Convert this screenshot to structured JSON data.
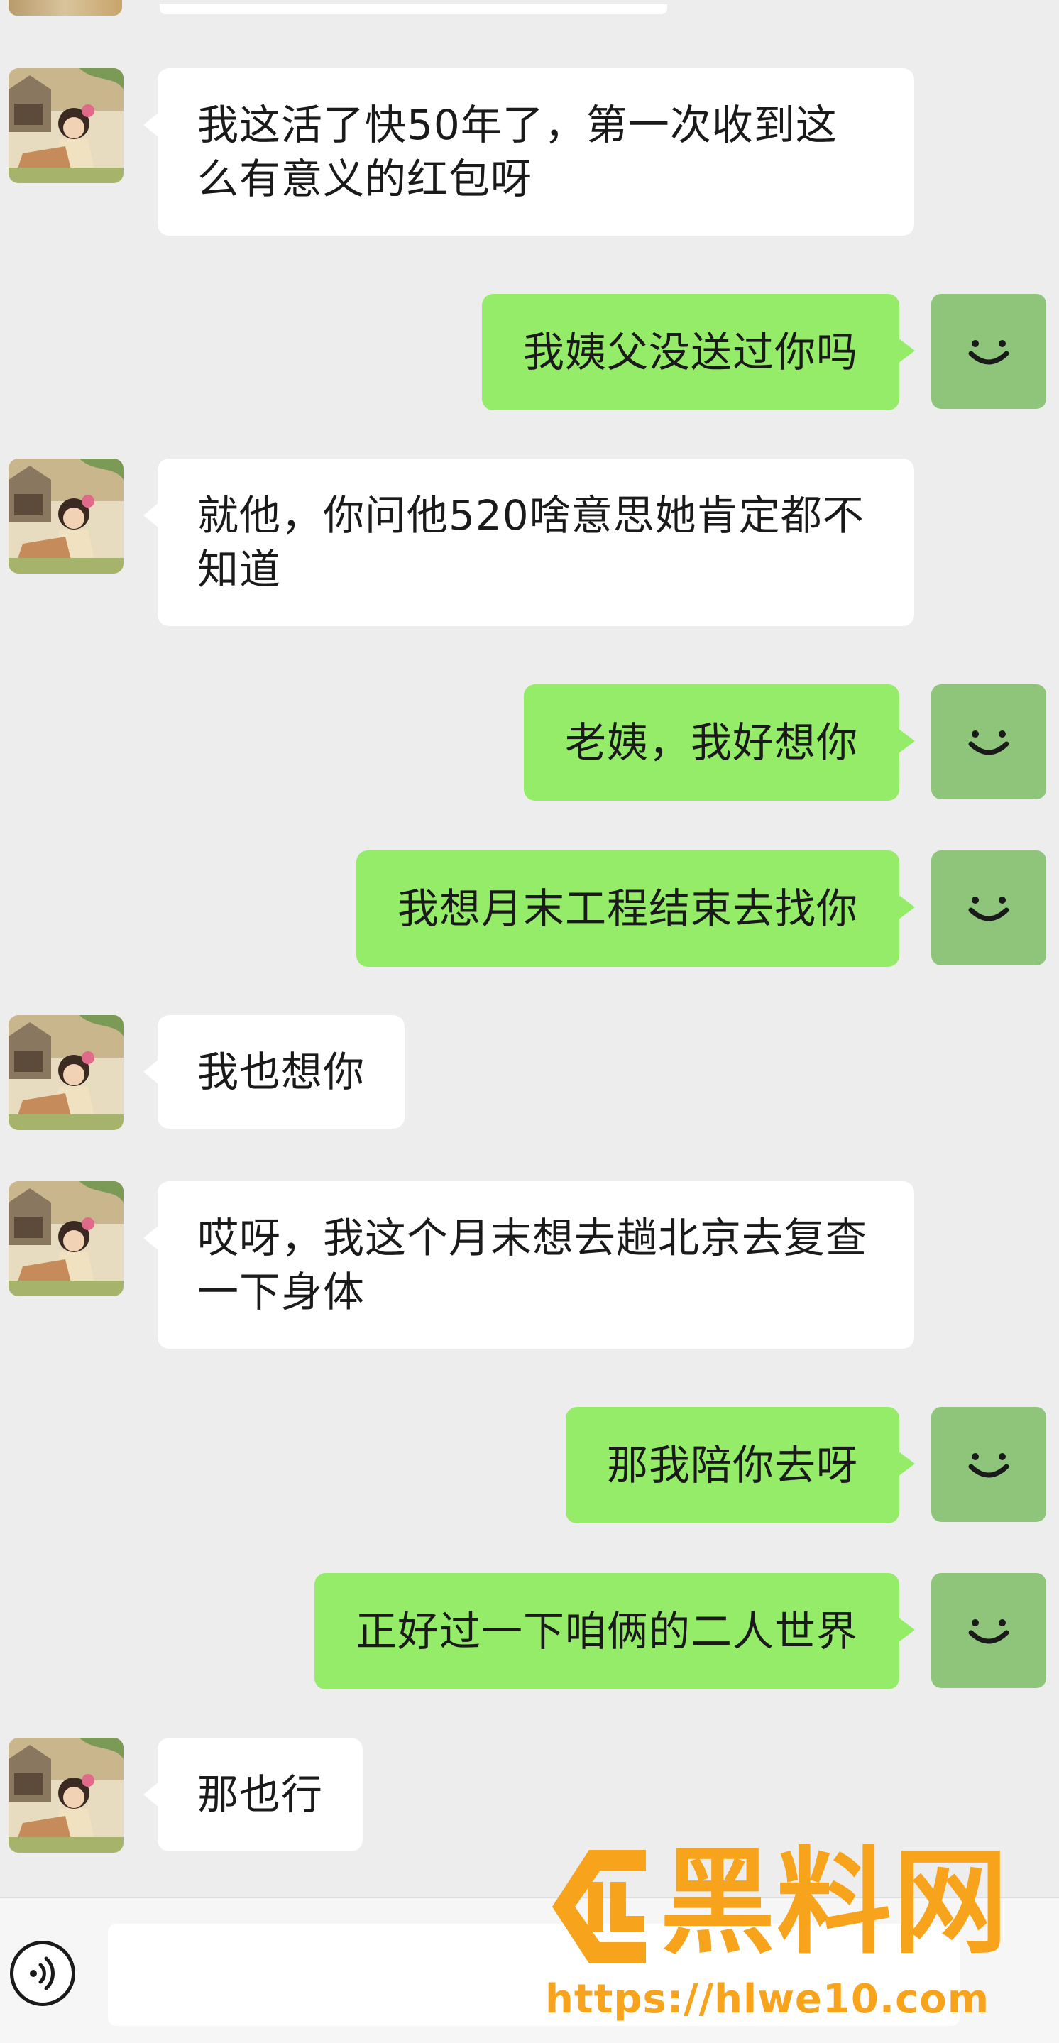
{
  "chat": {
    "messages": [
      {
        "side": "left",
        "text": "我这活了快50年了，第一次收到这么有意义的红包呀"
      },
      {
        "side": "right",
        "text": "我姨父没送过你吗"
      },
      {
        "side": "left",
        "text": "就他，你问他520啥意思她肯定都不知道"
      },
      {
        "side": "right",
        "text": "老姨，我好想你"
      },
      {
        "side": "right",
        "text": "我想月末工程结束去找你"
      },
      {
        "side": "left",
        "text": "我也想你"
      },
      {
        "side": "left",
        "text": "哎呀，我这个月末想去趟北京去复查一下身体"
      },
      {
        "side": "right",
        "text": "那我陪你去呀"
      },
      {
        "side": "right",
        "text": "正好过一下咱俩的二人世界"
      },
      {
        "side": "left",
        "text": "那也行"
      }
    ]
  },
  "icons": {
    "contact_avatar": "girl-portrait-avatar",
    "my_avatar": "smiley-avatar",
    "voice": "voice-input-icon"
  },
  "watermark": {
    "title": "黑料网",
    "url": "https://hlwe10.com",
    "color": "#f7a31c"
  },
  "colors": {
    "background": "#ededed",
    "incoming_bubble": "#ffffff",
    "outgoing_bubble": "#95ec69",
    "my_avatar": "#8ec57b"
  }
}
